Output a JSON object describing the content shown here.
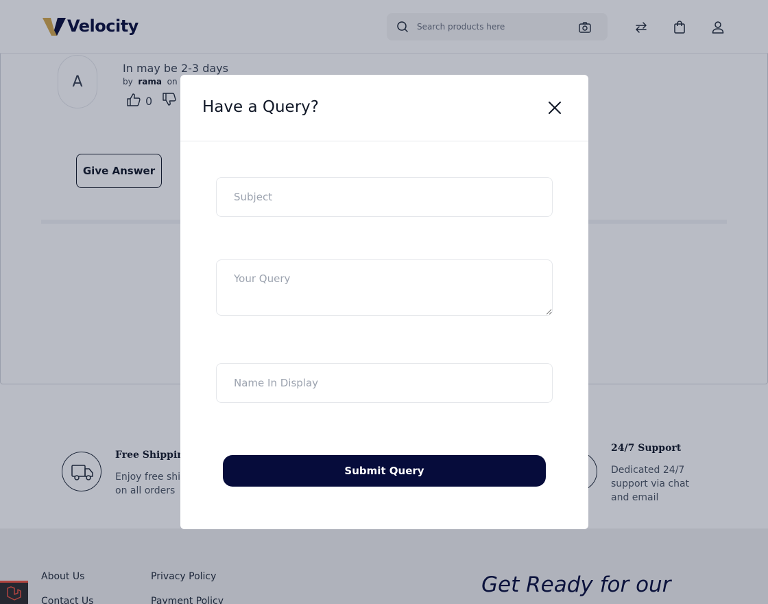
{
  "header": {
    "logo_text": "Velocity",
    "search_placeholder": "Search products here",
    "icons": [
      "search-icon",
      "camera-icon",
      "compare-icon",
      "cart-icon",
      "user-icon"
    ]
  },
  "qa": {
    "avatar_letter": "A",
    "answer_text": "In may be 2-3 days",
    "by_label": "by",
    "author": "rama",
    "on_label": "on",
    "likes": "0",
    "give_answer_label": "Give Answer"
  },
  "features": [
    {
      "title": "Free Shipping",
      "desc_line1": "Enjoy free ship",
      "desc_line2": "on all orders",
      "icon": "truck-icon"
    },
    {
      "title": "24/7 Support",
      "desc_line1": "Dedicated 24/7",
      "desc_line2": "support via chat",
      "desc_line3": "and email",
      "icon": "support-icon"
    }
  ],
  "footer": {
    "links_col1": [
      "About Us",
      "Contact Us"
    ],
    "links_col2": [
      "Privacy Policy",
      "Payment Policy"
    ],
    "newsletter_heading": "Get Ready for our"
  },
  "modal": {
    "title": "Have a Query?",
    "subject_placeholder": "Subject",
    "query_placeholder": "Your Query",
    "name_placeholder": "Name In Display",
    "submit_label": "Submit Query"
  },
  "colors": {
    "brand_navy": "#060c3b",
    "logo_gold": "#d4a84b",
    "overlay": "rgba(23,33,64,0.3)"
  }
}
